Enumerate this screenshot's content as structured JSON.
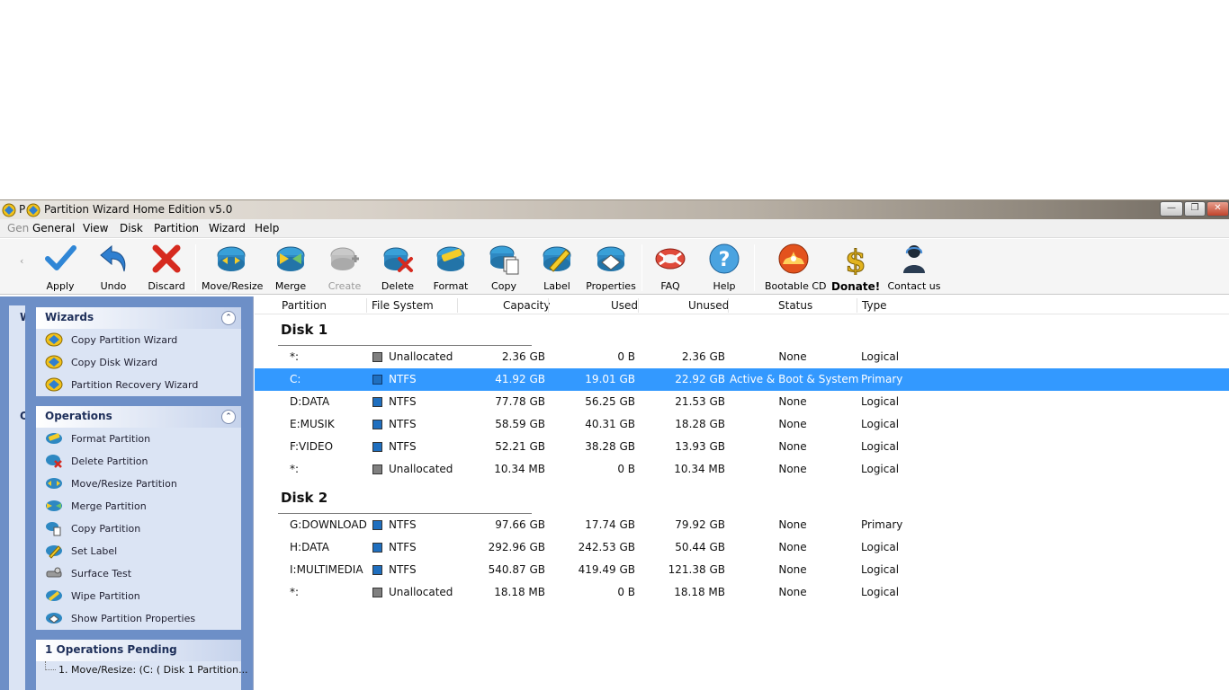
{
  "window": {
    "title": "Partition Wizard Home Edition v5.0",
    "title_prefix": "P"
  },
  "menu": {
    "ghost": "Gen",
    "items": [
      "General",
      "View",
      "Disk",
      "Partition",
      "Wizard",
      "Help"
    ]
  },
  "toolbar": {
    "apply": "Apply",
    "undo": "Undo",
    "discard": "Discard",
    "move_resize": "Move/Resize",
    "merge": "Merge",
    "create": "Create",
    "delete": "Delete",
    "format": "Format",
    "copy": "Copy",
    "label": "Label",
    "properties": "Properties",
    "faq": "FAQ",
    "help": "Help",
    "bootable_cd": "Bootable CD",
    "donate": "Donate!",
    "contact": "Contact us"
  },
  "left_strip": {
    "letters": [
      "W",
      "O"
    ]
  },
  "wizards": {
    "title": "Wizards",
    "items": [
      "Copy Partition Wizard",
      "Copy Disk Wizard",
      "Partition Recovery Wizard"
    ]
  },
  "operations": {
    "title": "Operations",
    "items": [
      "Format Partition",
      "Delete Partition",
      "Move/Resize Partition",
      "Merge Partition",
      "Copy Partition",
      "Set Label",
      "Surface Test",
      "Wipe Partition",
      "Show Partition Properties"
    ]
  },
  "pending": {
    "title": "1 Operations Pending",
    "items": [
      "1. Move/Resize: (C: ( Disk 1 Partition..."
    ]
  },
  "table": {
    "columns": [
      "Partition",
      "File System",
      "Capacity",
      "Used",
      "Unused",
      "Status",
      "Type"
    ],
    "disks": [
      {
        "name": "Disk 1",
        "rows": [
          {
            "partition": "*:",
            "fs": "Unallocated",
            "capacity": "2.36 GB",
            "used": "0 B",
            "unused": "2.36 GB",
            "status": "None",
            "type": "Logical"
          },
          {
            "partition": "C:",
            "fs": "NTFS",
            "capacity": "41.92 GB",
            "used": "19.01 GB",
            "unused": "22.92 GB",
            "status": "Active & Boot & System",
            "type": "Primary"
          },
          {
            "partition": "D:DATA",
            "fs": "NTFS",
            "capacity": "77.78 GB",
            "used": "56.25 GB",
            "unused": "21.53 GB",
            "status": "None",
            "type": "Logical"
          },
          {
            "partition": "E:MUSIK",
            "fs": "NTFS",
            "capacity": "58.59 GB",
            "used": "40.31 GB",
            "unused": "18.28 GB",
            "status": "None",
            "type": "Logical"
          },
          {
            "partition": "F:VIDEO",
            "fs": "NTFS",
            "capacity": "52.21 GB",
            "used": "38.28 GB",
            "unused": "13.93 GB",
            "status": "None",
            "type": "Logical"
          },
          {
            "partition": "*:",
            "fs": "Unallocated",
            "capacity": "10.34 MB",
            "used": "0 B",
            "unused": "10.34 MB",
            "status": "None",
            "type": "Logical"
          }
        ]
      },
      {
        "name": "Disk 2",
        "rows": [
          {
            "partition": "G:DOWNLOAD",
            "fs": "NTFS",
            "capacity": "97.66 GB",
            "used": "17.74 GB",
            "unused": "79.92 GB",
            "status": "None",
            "type": "Primary"
          },
          {
            "partition": "H:DATA",
            "fs": "NTFS",
            "capacity": "292.96 GB",
            "used": "242.53 GB",
            "unused": "50.44 GB",
            "status": "None",
            "type": "Logical"
          },
          {
            "partition": "I:MULTIMEDIA",
            "fs": "NTFS",
            "capacity": "540.87 GB",
            "used": "419.49 GB",
            "unused": "121.38 GB",
            "status": "None",
            "type": "Logical"
          },
          {
            "partition": "*:",
            "fs": "Unallocated",
            "capacity": "18.18 MB",
            "used": "0 B",
            "unused": "18.18 MB",
            "status": "None",
            "type": "Logical"
          }
        ]
      }
    ]
  },
  "colors": {
    "selection": "#3399ff",
    "panel_bg": "#6d8fc7",
    "ntfs": "#1f6fbf",
    "unallocated": "#808080"
  }
}
